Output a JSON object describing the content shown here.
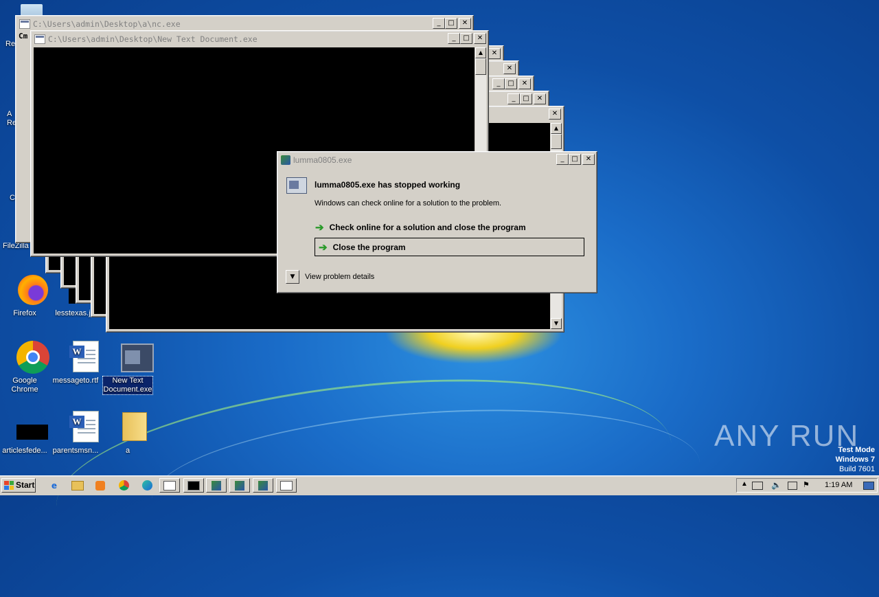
{
  "desktop": {
    "icons": [
      {
        "label": "Re",
        "icon": "recycle-bin-icon"
      },
      {
        "label": "A\nRe",
        "icon": "acrobat-reader-icon"
      },
      {
        "label": "C",
        "icon": "ccleaner-icon"
      },
      {
        "label": "FileZilla C",
        "icon": "filezilla-icon"
      },
      {
        "label": "Firefox",
        "icon": "firefox-icon"
      },
      {
        "label": "lesstexas.j",
        "icon": "black-file-icon"
      },
      {
        "label": "Google Chrome",
        "icon": "chrome-icon"
      },
      {
        "label": "messageto.rtf",
        "icon": "word-doc-icon"
      },
      {
        "label": "New Text Document.exe",
        "icon": "exe-window-icon"
      },
      {
        "label": "articlesfede...",
        "icon": "black-file-icon"
      },
      {
        "label": "parentsmsn...",
        "icon": "word-doc-icon"
      },
      {
        "label": "a",
        "icon": "folder-icon"
      }
    ]
  },
  "windows": {
    "back_title_prefix": "Cm",
    "nc_title": "C:\\Users\\admin\\Desktop\\a\\nc.exe",
    "ntd_title": "C:\\Users\\admin\\Desktop\\New Text Document.exe"
  },
  "dialog": {
    "title": "lumma0805.exe",
    "heading": "lumma0805.exe has stopped working",
    "message": "Windows can check online for a solution to the problem.",
    "option_check": "Check online for a solution and close the program",
    "option_close": "Close the program",
    "details": "View problem details"
  },
  "controls": {
    "minimize": "_",
    "maximize": "□",
    "close": "✕"
  },
  "taskbar": {
    "start_label": "Start",
    "items": [
      "ie-icon",
      "explorer-icon",
      "media-player-icon",
      "chrome-icon",
      "edge-icon",
      "window-icon",
      "cmd-icon",
      "lumma-icon",
      "lumma-icon",
      "lumma-icon",
      "window-icon"
    ],
    "clock": "1:19 AM"
  },
  "watermark": {
    "line1": "Test Mode",
    "line2": "Windows 7",
    "line3": "Build 7601",
    "brand": "ANY RUN"
  },
  "colors": {
    "arrow_green": "#2a9a2a",
    "selection_blue": "#0b246a",
    "console_black": "#000000"
  }
}
